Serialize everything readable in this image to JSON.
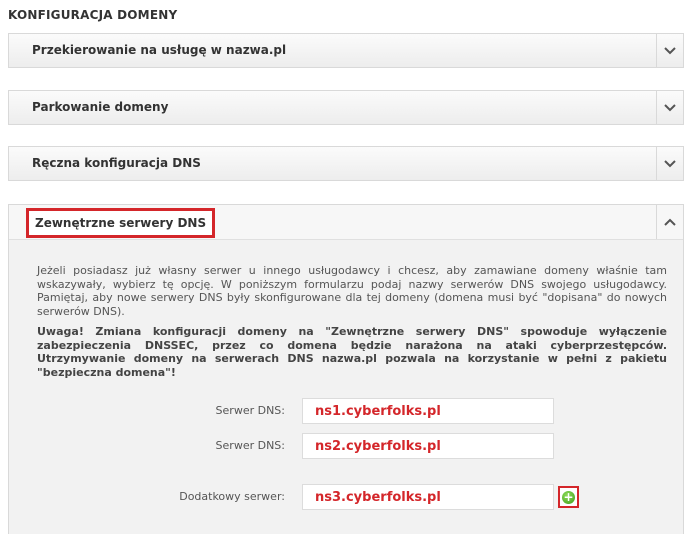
{
  "page_title": "KONFIGURACJA DOMENY",
  "sections": [
    {
      "label": "Przekierowanie na usługę w nazwa.pl",
      "icon": "chevron-down-icon"
    },
    {
      "label": "Parkowanie domeny",
      "icon": "chevron-down-icon"
    },
    {
      "label": "Ręczna konfiguracja DNS",
      "icon": "chevron-down-icon"
    }
  ],
  "external_dns": {
    "label": "Zewnętrzne serwery DNS",
    "icon": "chevron-up-icon",
    "highlight_color": "#d4262a",
    "info": "Jeżeli posiadasz już własny serwer u innego usługodawcy i chcesz, aby zamawiane domeny właśnie tam wskazywały, wybierz tę opcję. W poniższym formularzu podaj nazwy serwerów DNS swojego usługodawcy. Pamiętaj, aby nowe serwery DNS były skonfigurowane dla tej domeny (domena musi być \"dopisana\" do nowych serwerów DNS).",
    "warning": "Uwaga! Zmiana konfiguracji domeny na \"Zewnętrzne serwery DNS\" spowoduje wyłączenie zabezpieczenia DNSSEC, przez co domena będzie narażona na ataki cyberprzestępców. Utrzymywanie domeny na serwerach DNS nazwa.pl pozwala na korzystanie w pełni z pakietu \"bezpieczna domena\"!",
    "fields": [
      {
        "label": "Serwer DNS:",
        "value": "ns1.cyberfolks.pl"
      },
      {
        "label": "Serwer DNS:",
        "value": "ns2.cyberfolks.pl"
      },
      {
        "label": "Dodatkowy serwer:",
        "value": "ns3.cyberfolks.pl"
      }
    ],
    "add_icon": "plus-circle-icon",
    "add_symbol": "+"
  }
}
